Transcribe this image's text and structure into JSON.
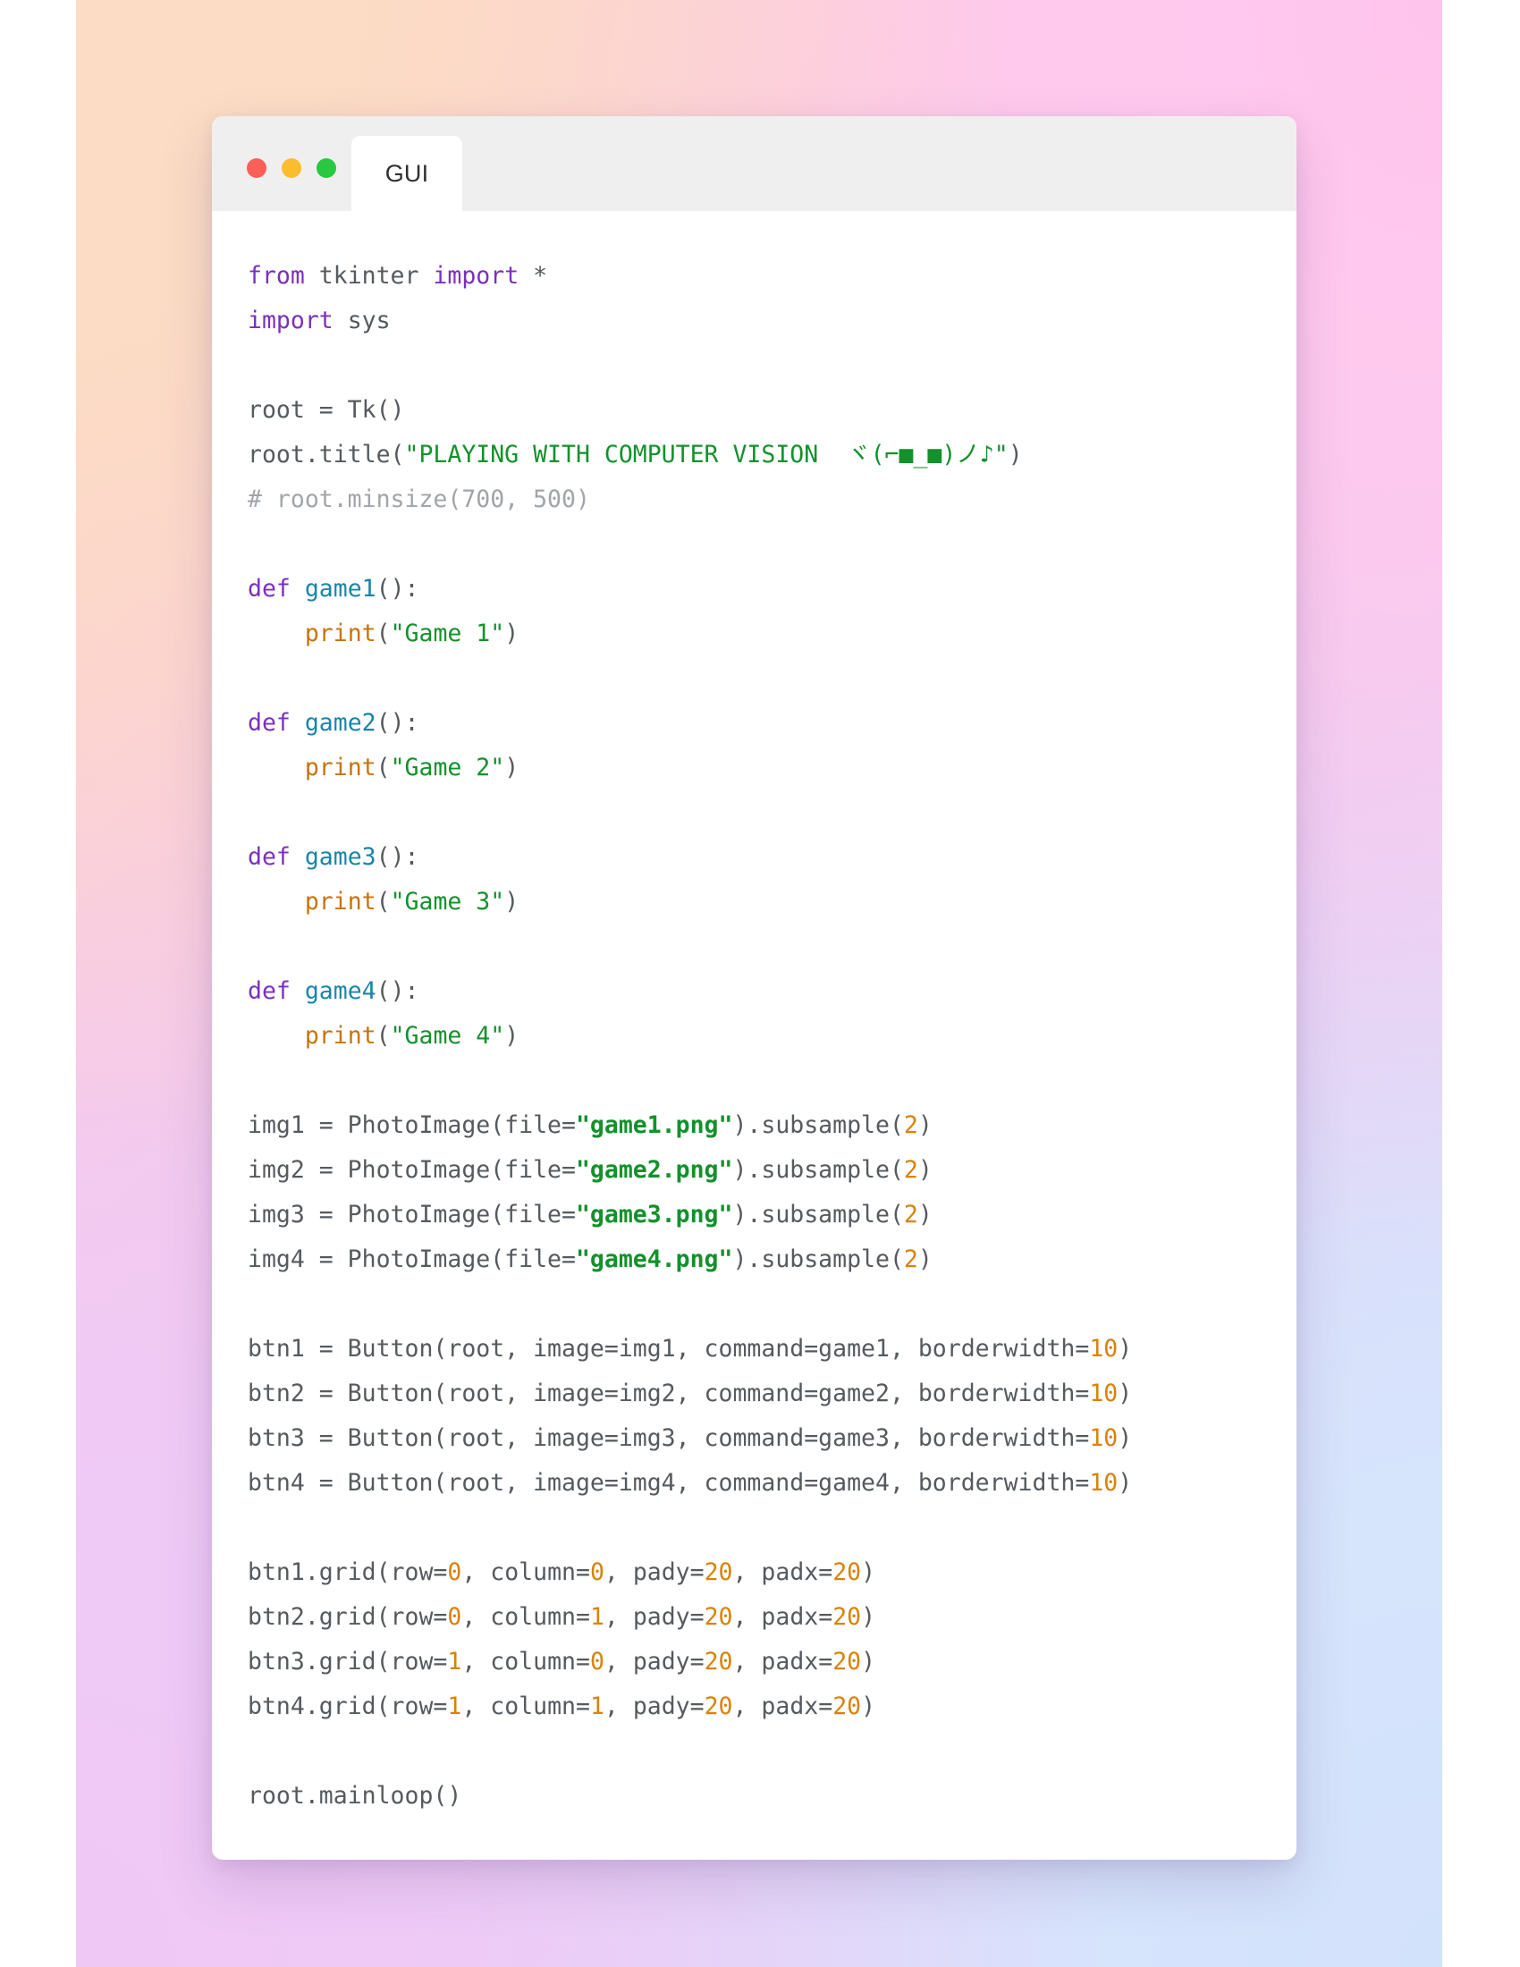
{
  "window": {
    "traffic_lights": [
      {
        "name": "close",
        "color": "#fb5f57"
      },
      {
        "name": "minimize",
        "color": "#fcbc2e"
      },
      {
        "name": "zoom",
        "color": "#28c840"
      }
    ],
    "tab_label": "GUI"
  },
  "theme": {
    "keyword_color": "#7b2fbe",
    "function_color": "#1a85a8",
    "builtin_color": "#c8730d",
    "string_color": "#13912b",
    "number_color": "#d9820b",
    "comment_color": "#a0a5aa",
    "plain_color": "#555a5f",
    "card_background": "#ffffff",
    "titlebar_background": "#efefef",
    "backdrop_top_left": "#fbd9c6",
    "backdrop_top_right": "#ffc9ee",
    "backdrop_bottom_left": "#efcaf7",
    "backdrop_bottom_right": "#d6e4fc"
  },
  "code": {
    "language": "python",
    "window_title_string": "PLAYING WITH COMPUTER VISION  ヾ(⌐■_■)ノ♪",
    "lines": [
      "from tkinter import *",
      "import sys",
      "",
      "root = Tk()",
      "root.title(\"PLAYING WITH COMPUTER VISION  ヾ(⌐■_■)ノ♪\")",
      "# root.minsize(700, 500)",
      "",
      "def game1():",
      "    print(\"Game 1\")",
      "",
      "def game2():",
      "    print(\"Game 2\")",
      "",
      "def game3():",
      "    print(\"Game 3\")",
      "",
      "def game4():",
      "    print(\"Game 4\")",
      "",
      "img1 = PhotoImage(file=\"game1.png\").subsample(2)",
      "img2 = PhotoImage(file=\"game2.png\").subsample(2)",
      "img3 = PhotoImage(file=\"game3.png\").subsample(2)",
      "img4 = PhotoImage(file=\"game4.png\").subsample(2)",
      "",
      "btn1 = Button(root, image=img1, command=game1, borderwidth=10)",
      "btn2 = Button(root, image=img2, command=game2, borderwidth=10)",
      "btn3 = Button(root, image=img3, command=game3, borderwidth=10)",
      "btn4 = Button(root, image=img4, command=game4, borderwidth=10)",
      "",
      "btn1.grid(row=0, column=0, pady=20, padx=20)",
      "btn2.grid(row=0, column=1, pady=20, padx=20)",
      "btn3.grid(row=1, column=0, pady=20, padx=20)",
      "btn4.grid(row=1, column=1, pady=20, padx=20)",
      "",
      "root.mainloop()"
    ],
    "html": "<span class=\"kw\">from</span> tkinter <span class=\"kw\">import</span> *\n<span class=\"kw\">import</span> sys\n\nroot = Tk()\nroot.title(<span class=\"str\">\"PLAYING WITH COMPUTER VISION  ヾ(⌐■_■)ノ♪\"</span>)\n<span class=\"cmt\"># root.minsize(700, 500)</span>\n\n<span class=\"kw\">def</span> <span class=\"fn\">game1</span>():\n    <span class=\"bi\">print</span>(<span class=\"str\">\"Game 1\"</span>)\n\n<span class=\"kw\">def</span> <span class=\"fn\">game2</span>():\n    <span class=\"bi\">print</span>(<span class=\"str\">\"Game 2\"</span>)\n\n<span class=\"kw\">def</span> <span class=\"fn\">game3</span>():\n    <span class=\"bi\">print</span>(<span class=\"str\">\"Game 3\"</span>)\n\n<span class=\"kw\">def</span> <span class=\"fn\">game4</span>():\n    <span class=\"bi\">print</span>(<span class=\"str\">\"Game 4\"</span>)\n\nimg1 = PhotoImage(file=<span class=\"strb\">\"game1.png\"</span>).subsample(<span class=\"num\">2</span>)\nimg2 = PhotoImage(file=<span class=\"strb\">\"game2.png\"</span>).subsample(<span class=\"num\">2</span>)\nimg3 = PhotoImage(file=<span class=\"strb\">\"game3.png\"</span>).subsample(<span class=\"num\">2</span>)\nimg4 = PhotoImage(file=<span class=\"strb\">\"game4.png\"</span>).subsample(<span class=\"num\">2</span>)\n\nbtn1 = Button(root, image=img1, command=game1, borderwidth=<span class=\"num\">10</span>)\nbtn2 = Button(root, image=img2, command=game2, borderwidth=<span class=\"num\">10</span>)\nbtn3 = Button(root, image=img3, command=game3, borderwidth=<span class=\"num\">10</span>)\nbtn4 = Button(root, image=img4, command=game4, borderwidth=<span class=\"num\">10</span>)\n\nbtn1.grid(row=<span class=\"num\">0</span>, column=<span class=\"num\">0</span>, pady=<span class=\"num\">20</span>, padx=<span class=\"num\">20</span>)\nbtn2.grid(row=<span class=\"num\">0</span>, column=<span class=\"num\">1</span>, pady=<span class=\"num\">20</span>, padx=<span class=\"num\">20</span>)\nbtn3.grid(row=<span class=\"num\">1</span>, column=<span class=\"num\">0</span>, pady=<span class=\"num\">20</span>, padx=<span class=\"num\">20</span>)\nbtn4.grid(row=<span class=\"num\">1</span>, column=<span class=\"num\">1</span>, pady=<span class=\"num\">20</span>, padx=<span class=\"num\">20</span>)\n\nroot.mainloop()"
  }
}
